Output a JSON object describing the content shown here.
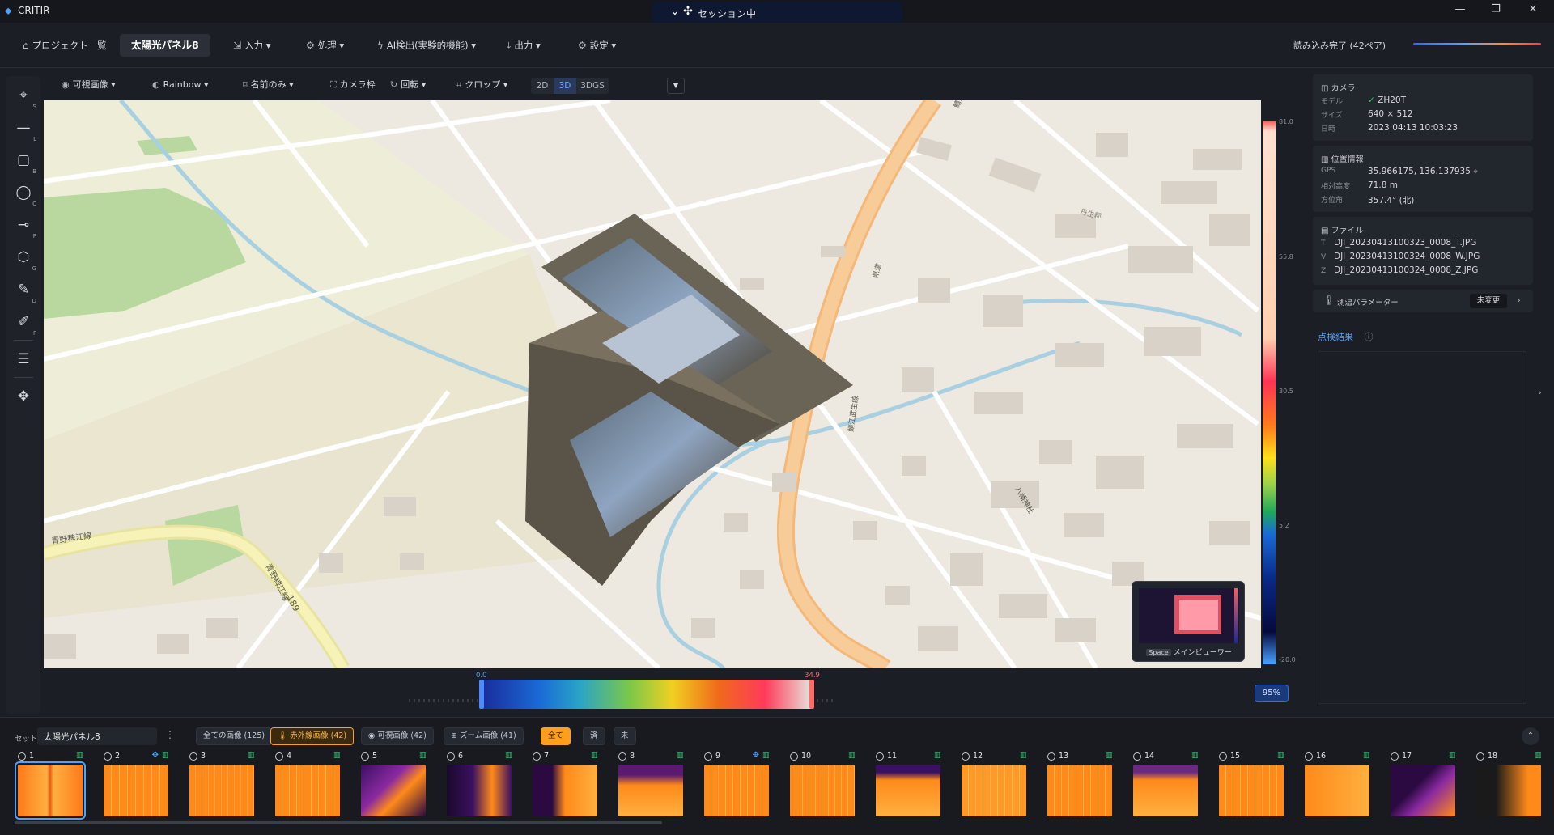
{
  "app": {
    "name": "CRITIR",
    "session": "セッション中"
  },
  "menu": {
    "project_list": "プロジェクト一覧",
    "current_project": "太陽光パネル8",
    "input": "入力",
    "process": "処理",
    "ai_detect": "AI検出(実験的機能)",
    "output": "出力",
    "settings": "設定",
    "load_status": "読み込み完了 (42ペア)"
  },
  "toolbar": {
    "visible_image": "可視画像",
    "palette": "Rainbow",
    "name_only": "名前のみ",
    "camera_frame": "カメラ枠",
    "rotate": "回転",
    "crop": "クロップ",
    "mode_2d": "2D",
    "mode_3d": "3D",
    "mode_3dgs": "3DGS"
  },
  "left_tools": [
    {
      "icon": "crosshair-icon",
      "key": "S"
    },
    {
      "icon": "line-icon",
      "key": "L"
    },
    {
      "icon": "rectangle-icon",
      "key": "B"
    },
    {
      "icon": "circle-icon",
      "key": "C"
    },
    {
      "icon": "point-icon",
      "key": "P"
    },
    {
      "icon": "polygon-icon",
      "key": "G"
    },
    {
      "icon": "pencil-icon",
      "key": "D"
    },
    {
      "icon": "edit-icon",
      "key": "F"
    },
    {
      "icon": "sliders-icon",
      "key": ""
    },
    {
      "icon": "move-icon",
      "key": ""
    }
  ],
  "map_labels": {
    "road_a": "青野稗江線",
    "road_b": "青野稗江線",
    "route": "189",
    "road_c": "鯖江武生線",
    "road_d": "県道",
    "shrine": "八幡神社",
    "town": "丹生郡"
  },
  "thermal_scale": {
    "max": "81.0",
    "t1": "55.8",
    "t2": "30.5",
    "t3": "5.2",
    "min": "-20.0"
  },
  "range": {
    "low": "0.0",
    "high": "34.9",
    "zoom": "95%"
  },
  "minimap": {
    "key": "Space",
    "label": "メインビューワー"
  },
  "camera": {
    "title": "カメラ",
    "model_key": "モデル",
    "model": "ZH20T",
    "size_key": "サイズ",
    "size": "640 × 512",
    "date_key": "日時",
    "date": "2023:04:13 10:03:23"
  },
  "location": {
    "title": "位置情報",
    "gps_key": "GPS",
    "gps": "35.966175, 136.137935",
    "alt_key": "相対高度",
    "alt": "71.8 m",
    "dir_key": "方位角",
    "dir": "357.4° (北)"
  },
  "files": {
    "title": "ファイル",
    "list": [
      {
        "p": "T",
        "name": "DJI_20230413100323_0008_T.JPG"
      },
      {
        "p": "V",
        "name": "DJI_20230413100324_0008_W.JPG"
      },
      {
        "p": "Z",
        "name": "DJI_20230413100324_0008_Z.JPG"
      }
    ]
  },
  "params": {
    "label": "測温パラメーター",
    "state": "未変更"
  },
  "results": {
    "title": "点検結果"
  },
  "bottom": {
    "set_label": "セット:",
    "set_value": "太陽光パネル8",
    "filters": [
      {
        "label": "全ての画像 (125)"
      },
      {
        "label": "赤外線画像 (42)"
      },
      {
        "label": "可視画像 (42)"
      },
      {
        "label": "ズーム画像 (41)"
      }
    ],
    "status_filters": [
      "全て",
      "済",
      "未"
    ]
  },
  "thumbs": [
    "1",
    "2",
    "3",
    "4",
    "5",
    "6",
    "7",
    "8",
    "9",
    "10",
    "11",
    "12",
    "13",
    "14",
    "15",
    "16",
    "17",
    "18"
  ],
  "colors": {
    "accent": "#4ea1ff",
    "active_filter": "#ff9f1c",
    "ok": "#2ecc71"
  }
}
